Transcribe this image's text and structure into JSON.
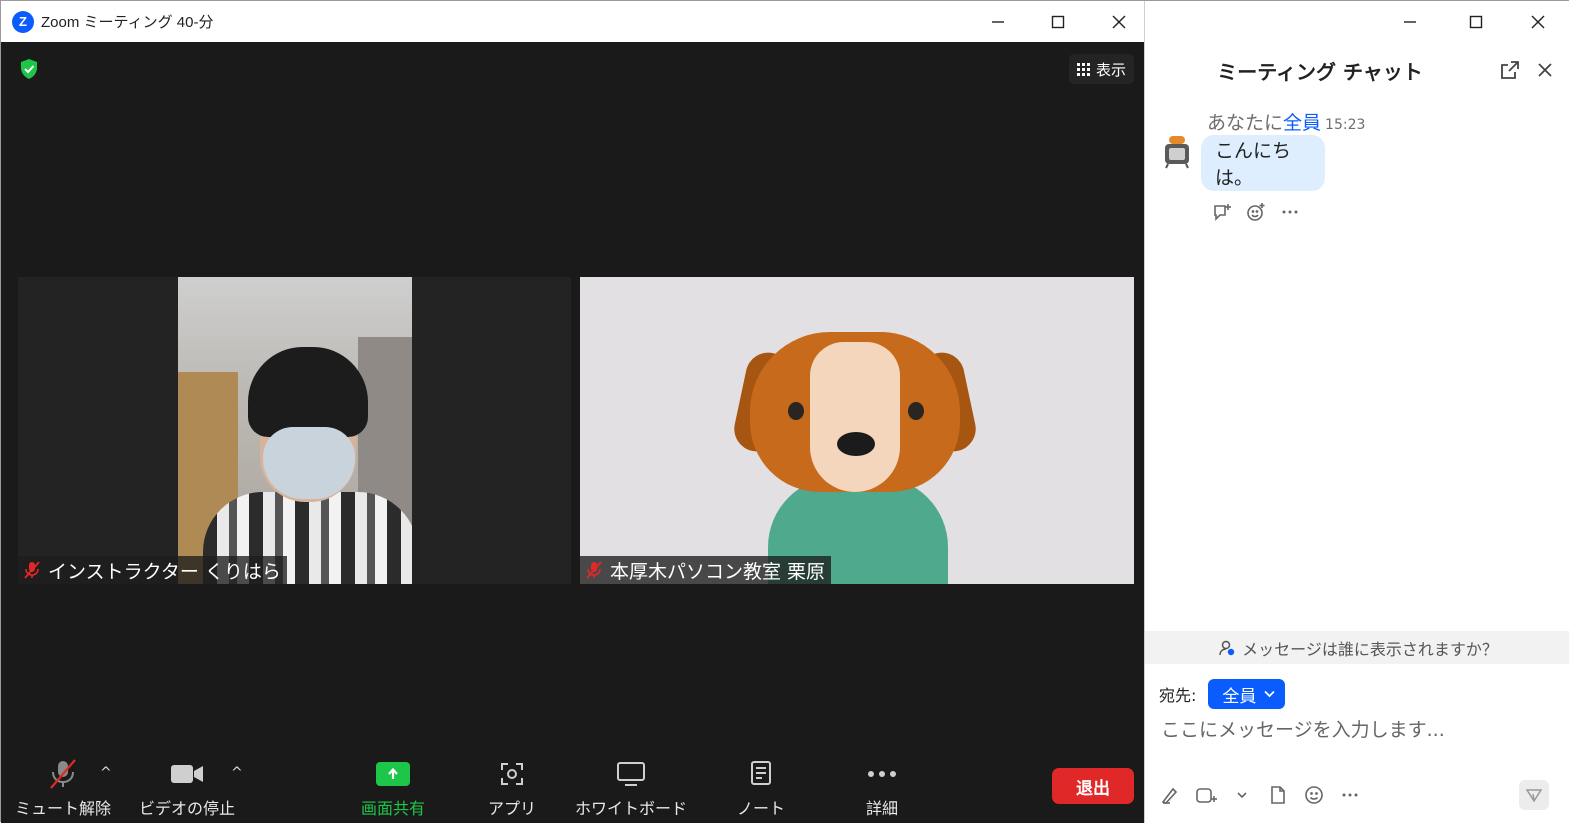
{
  "window": {
    "title": "Zoom ミーティング 40-分"
  },
  "stage": {
    "view_button_label": "表示"
  },
  "participants": [
    {
      "name": "インストラクター くりはら",
      "muted": true,
      "video": "camera"
    },
    {
      "name": "本厚木パソコン教室 栗原",
      "muted": true,
      "video": "avatar-dog"
    }
  ],
  "toolbar": {
    "mute_label": "ミュート解除",
    "video_label": "ビデオの停止",
    "share_label": "画面共有",
    "apps_label": "アプリ",
    "whiteboard_label": "ホワイトボード",
    "notes_label": "ノート",
    "more_label": "詳細",
    "leave_label": "退出"
  },
  "chat": {
    "title": "ミーティング チャット",
    "messages": [
      {
        "prefix": "あなたに",
        "to": "全員",
        "time": "15:23",
        "text": "こんにちは。"
      }
    ],
    "who_can_see": "メッセージは誰に表示されますか？",
    "to_label": "宛先:",
    "to_value": "全員",
    "input_placeholder": "ここにメッセージを入力します..."
  },
  "colors": {
    "brand_blue": "#0b5cff",
    "share_green": "#1dc548",
    "leave_red": "#e02828",
    "stage_bg": "#1a1a1a",
    "bubble_bg": "#dfeeff"
  },
  "icons": [
    "zoom-logo-icon",
    "shield-icon",
    "grid-icon",
    "microphone-muted-icon",
    "video-camera-icon",
    "share-screen-icon",
    "apps-icon",
    "whiteboard-icon",
    "notes-icon",
    "more-icon",
    "popout-icon",
    "close-icon",
    "reply-icon",
    "emoji-icon",
    "person-icon",
    "chevron-down-icon",
    "format-icon",
    "screenshot-icon",
    "file-icon",
    "send-icon"
  ]
}
